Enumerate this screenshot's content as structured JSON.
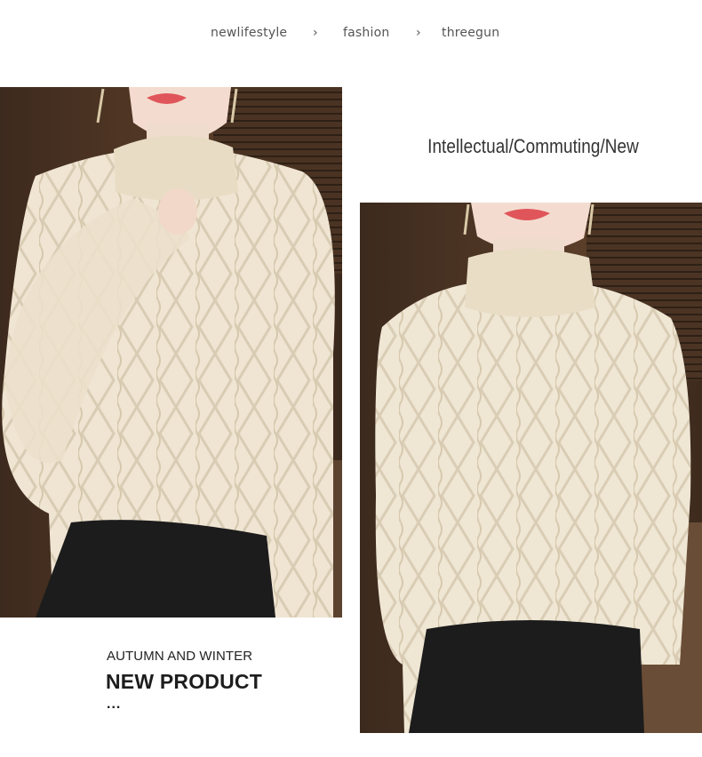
{
  "breadcrumb": {
    "items": [
      "newlifestyle",
      "fashion",
      "threegun"
    ],
    "separator": "›"
  },
  "headline": "Intellectual/Commuting/New",
  "promo": {
    "subtitle": "AUTUMN AND WINTER",
    "title": "NEW PRODUCT",
    "ellipsis": "..."
  },
  "colors": {
    "sweater": "#efe5d2",
    "background_wall": "#4b3425",
    "skirt": "#1c1c1c",
    "lips": "#e0555a",
    "skin": "#f3dccf"
  }
}
